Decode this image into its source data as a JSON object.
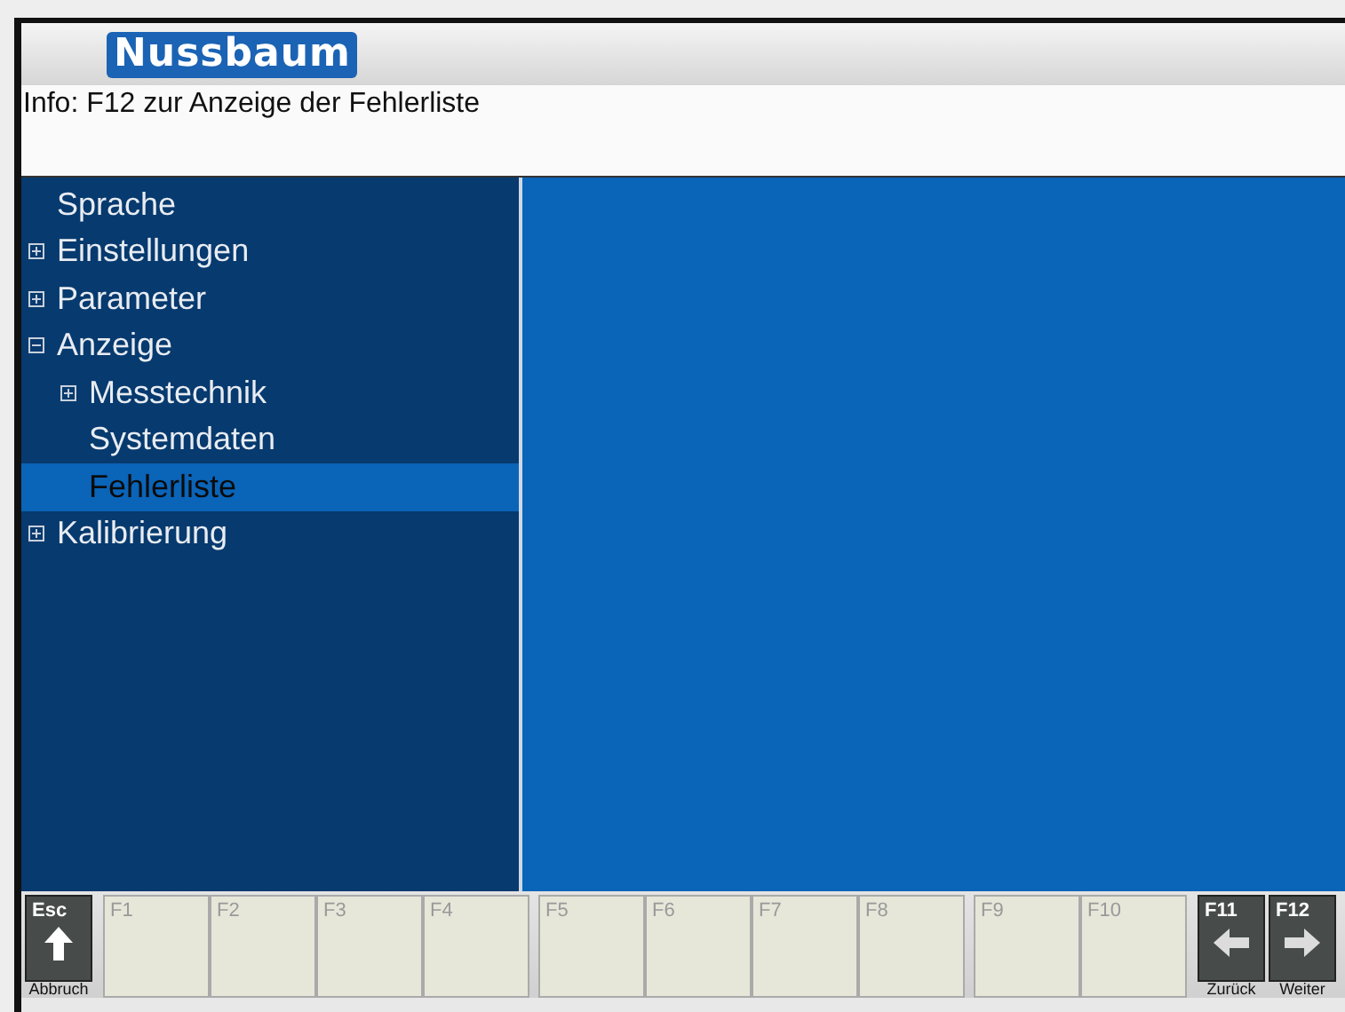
{
  "header": {
    "logo": "Nussbaum"
  },
  "info": {
    "text": "Info: F12 zur Anzeige der Fehlerliste"
  },
  "tree": [
    {
      "label": "Sprache",
      "kind": "leaf",
      "selected": false
    },
    {
      "label": "Einstellungen",
      "kind": "group",
      "expanded": false,
      "selected": false
    },
    {
      "label": "Parameter",
      "kind": "group",
      "expanded": false,
      "selected": false
    },
    {
      "label": "Anzeige",
      "kind": "group",
      "expanded": true,
      "selected": false,
      "children": [
        {
          "label": "Messtechnik",
          "kind": "group",
          "expanded": false,
          "selected": false
        },
        {
          "label": "Systemdaten",
          "kind": "leaf",
          "selected": false
        },
        {
          "label": "Fehlerliste",
          "kind": "leaf",
          "selected": true
        }
      ]
    },
    {
      "label": "Kalibrierung",
      "kind": "group",
      "expanded": false,
      "selected": false
    }
  ],
  "function_keys": [
    {
      "key": "Esc",
      "kind": "up",
      "caption": "Abbruch"
    },
    {
      "key": "F1",
      "kind": "blank"
    },
    {
      "key": "F2",
      "kind": "blank"
    },
    {
      "key": "F3",
      "kind": "blank"
    },
    {
      "key": "F4",
      "kind": "blank"
    },
    {
      "key": "F5",
      "kind": "blank"
    },
    {
      "key": "F6",
      "kind": "blank"
    },
    {
      "key": "F7",
      "kind": "blank"
    },
    {
      "key": "F8",
      "kind": "blank"
    },
    {
      "key": "F9",
      "kind": "blank"
    },
    {
      "key": "F10",
      "kind": "blank"
    },
    {
      "key": "F11",
      "kind": "back",
      "caption": "Zurück"
    },
    {
      "key": "F12",
      "kind": "forward",
      "caption": "Weiter"
    }
  ]
}
